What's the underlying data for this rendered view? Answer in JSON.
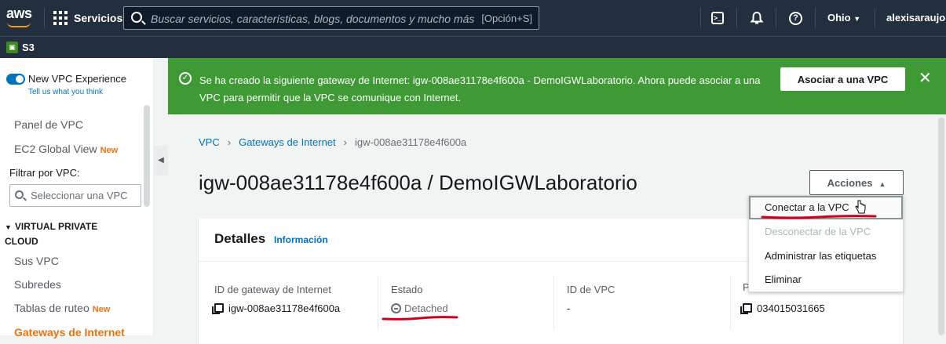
{
  "topbar": {
    "logo_text": "aws",
    "services_label": "Servicios",
    "search_placeholder": "Buscar servicios, características, blogs, documentos y mucho más",
    "search_shortcut": "[Opción+S]",
    "region": "Ohio",
    "user": "alexisaraujom"
  },
  "favorites": {
    "s3_label": "S3"
  },
  "sidebar": {
    "new_vpc_experience": "New VPC Experience",
    "tell_us": "Tell us what you think",
    "items": [
      {
        "label": "Panel de VPC",
        "badge": ""
      },
      {
        "label": "EC2 Global View",
        "badge": "New"
      }
    ],
    "filter_label": "Filtrar por VPC:",
    "filter_placeholder": "Seleccionar una VPC",
    "section_title": "VIRTUAL PRIVATE CLOUD",
    "section_items": [
      {
        "label": "Sus VPC",
        "badge": ""
      },
      {
        "label": "Subredes",
        "badge": ""
      },
      {
        "label": "Tablas de ruteo",
        "badge": "New"
      },
      {
        "label": "Gateways de Internet",
        "badge": "",
        "active": true
      }
    ]
  },
  "flash": {
    "message": "Se ha creado la siguiente gateway de Internet: igw-008ae31178e4f600a - DemoIGWLaboratorio. Ahora puede asociar a una VPC para permitir que la VPC se comunique con Internet.",
    "button": "Asociar a una VPC",
    "color": "#3f9a36"
  },
  "breadcrumb": [
    "VPC",
    "Gateways de Internet",
    "igw-008ae31178e4f600a"
  ],
  "page_title": "igw-008ae31178e4f600a / DemoIGWLaboratorio",
  "actions_button": "Acciones",
  "actions_menu": [
    {
      "label": "Conectar a la VPC",
      "state": "hover"
    },
    {
      "label": "Desconectar de la VPC",
      "state": "disabled"
    },
    {
      "label": "Administrar las etiquetas",
      "state": "enabled"
    },
    {
      "label": "Eliminar",
      "state": "enabled"
    }
  ],
  "details": {
    "title": "Detalles",
    "info_link": "Información",
    "fields": [
      {
        "label": "ID de gateway de Internet",
        "value": "igw-008ae31178e4f600a"
      },
      {
        "label": "Estado",
        "value": "Detached"
      },
      {
        "label": "ID de VPC",
        "value": "-"
      },
      {
        "label": "P",
        "value": "034015031665"
      }
    ]
  },
  "colors": {
    "aws_navy": "#232f3e",
    "aws_orange": "#ec7211",
    "link_blue": "#0073bb",
    "annotation_red": "#d0021b"
  },
  "icons": [
    "grid-icon",
    "search-icon",
    "cloudshell-icon",
    "bell-icon",
    "help-icon",
    "check-circle-icon",
    "close-icon",
    "copy-icon",
    "minus-circle-icon",
    "caret-up-icon",
    "hand-cursor-icon"
  ]
}
